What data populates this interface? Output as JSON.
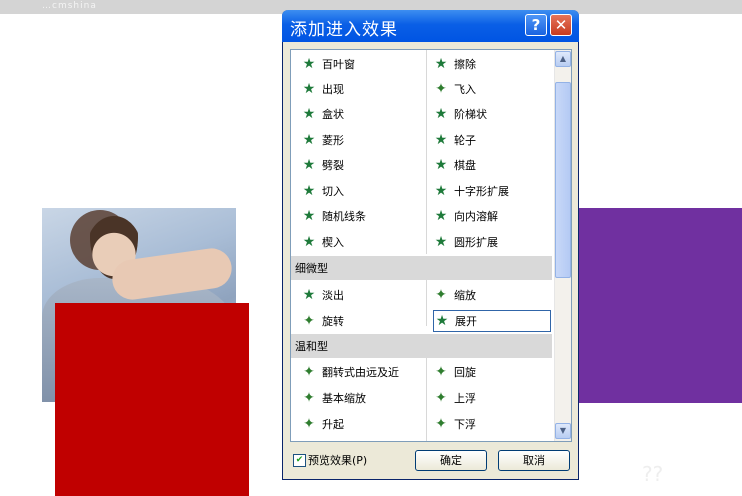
{
  "background": {
    "top_strip_text": "…cmshina",
    "corner_watermark": "??"
  },
  "dialog": {
    "title": "添加进入效果",
    "help_label": "?",
    "close_label": "✕",
    "effects_top": [
      {
        "label": "百叶窗",
        "icon": "star-icon"
      },
      {
        "label": "擦除",
        "icon": "star-icon"
      },
      {
        "label": "出现",
        "icon": "star-icon"
      },
      {
        "label": "飞入",
        "icon": "wand-icon"
      },
      {
        "label": "盒状",
        "icon": "star-icon"
      },
      {
        "label": "阶梯状",
        "icon": "star-icon"
      },
      {
        "label": "菱形",
        "icon": "star-icon"
      },
      {
        "label": "轮子",
        "icon": "star-icon"
      },
      {
        "label": "劈裂",
        "icon": "star-icon"
      },
      {
        "label": "棋盘",
        "icon": "star-icon"
      },
      {
        "label": "切入",
        "icon": "star-icon"
      },
      {
        "label": "十字形扩展",
        "icon": "star-icon"
      },
      {
        "label": "随机线条",
        "icon": "star-icon"
      },
      {
        "label": "向内溶解",
        "icon": "star-icon"
      },
      {
        "label": "楔入",
        "icon": "star-icon"
      },
      {
        "label": "圆形扩展",
        "icon": "star-icon"
      }
    ],
    "category_subtle": "细微型",
    "effects_subtle": [
      {
        "label": "淡出",
        "icon": "star-icon"
      },
      {
        "label": "缩放",
        "icon": "wand-icon"
      },
      {
        "label": "旋转",
        "icon": "wand-icon"
      },
      {
        "label": "展开",
        "icon": "star-icon"
      }
    ],
    "category_moderate": "温和型",
    "effects_moderate": [
      {
        "label": "翻转式由远及近",
        "icon": "wand-icon"
      },
      {
        "label": "回旋",
        "icon": "wand-icon"
      },
      {
        "label": "基本缩放",
        "icon": "wand-icon"
      },
      {
        "label": "上浮",
        "icon": "wand-icon"
      },
      {
        "label": "升起",
        "icon": "wand-icon"
      },
      {
        "label": "下浮",
        "icon": "wand-icon"
      }
    ],
    "selected_effect": "展开",
    "preview_label": "预览效果(P)",
    "preview_checked": true,
    "ok_label": "确定",
    "cancel_label": "取消"
  }
}
